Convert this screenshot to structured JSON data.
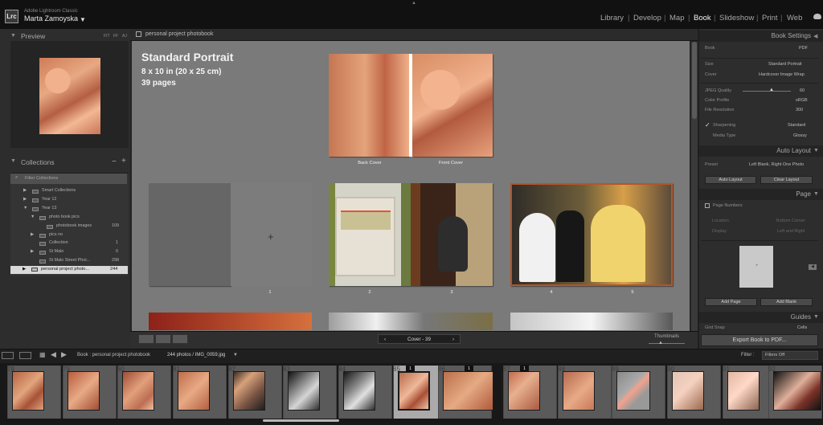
{
  "app": {
    "name": "Adobe Lightroom Classic",
    "logo": "Lrc",
    "user": "Marta Zamoyska"
  },
  "modules": [
    "Library",
    "Develop",
    "Map",
    "Book",
    "Slideshow",
    "Print",
    "Web"
  ],
  "left": {
    "preview_label": "Preview",
    "preview_buttons": [
      "FIT",
      "FF",
      "AJ"
    ],
    "collections_label": "Collections",
    "filter_label": "Filter Collections",
    "items": [
      {
        "label": "Smart Collections",
        "count": ""
      },
      {
        "label": "Year 12",
        "count": ""
      },
      {
        "label": "Year 13",
        "count": ""
      },
      {
        "label": "photo book pics",
        "count": ""
      },
      {
        "label": "photobook images",
        "count": "109"
      },
      {
        "label": "pics no",
        "count": ""
      },
      {
        "label": "Collection",
        "count": "1"
      },
      {
        "label": "St Malo",
        "count": "0"
      },
      {
        "label": "St Malo Street Phot...",
        "count": "298"
      },
      {
        "label": "personal project photo...",
        "count": "244"
      }
    ]
  },
  "center": {
    "title": "personal project photobook",
    "book_title": "Standard Portrait",
    "book_size": "8 x 10 in (20 x 25 cm)",
    "book_pages": "39 pages",
    "captions": {
      "back": "Back Cover",
      "front": "Front Cover",
      "p1": "1",
      "p2": "2",
      "p3": "3",
      "p4": "4",
      "p5": "5"
    },
    "nav": "Cover - 39",
    "thumbnails_label": "Thumbnails"
  },
  "right": {
    "book_settings": "Book Settings",
    "book": {
      "label": "Book",
      "value": "PDF"
    },
    "size": {
      "label": "Size",
      "value": "Standard Portrait"
    },
    "cover": {
      "label": "Cover",
      "value": "Hardcover Image Wrap"
    },
    "jpeg": {
      "label": "JPEG Quality",
      "value": "60"
    },
    "profile": {
      "label": "Color Profile",
      "value": "sRGB"
    },
    "resolution": {
      "label": "File Resolution",
      "value": "300"
    },
    "sharpening": {
      "label": "Sharpening",
      "value": "Standard"
    },
    "media": {
      "label": "Media Type",
      "value": "Glossy"
    },
    "auto_layout": "Auto Layout",
    "preset": {
      "label": "Preset",
      "value": "Left Blank, Right One Photo"
    },
    "auto_button": "Auto Layout",
    "clear_button": "Clear Layout",
    "page_header": "Page",
    "page_numbers": "Page Numbers",
    "location": {
      "label": "Location",
      "value": "Bottom Corner"
    },
    "display": {
      "label": "Display",
      "value": "Left and Right"
    },
    "add_page": "Add Page",
    "add_blank": "Add Blank",
    "guides": "Guides",
    "grid_snap": {
      "label": "Grid Snap",
      "value": "Cells"
    },
    "export": "Export Book to PDF..."
  },
  "filmstrip": {
    "path": "Book : personal project photobook",
    "count": "244 photos / IMG_0059.jpg",
    "filter_label": "Filter :",
    "filter_value": "Filters Off",
    "numbers": [
      "78",
      "79",
      "80",
      "81",
      "82",
      "83",
      "84",
      "85",
      "86",
      "87",
      "88",
      "89",
      "90",
      "91",
      "92"
    ],
    "badges": [
      "1",
      "1",
      "1"
    ]
  },
  "colors": {
    "accent": "#ffffff",
    "selected": "#d8d8d8",
    "canvas": "#7a7a7a",
    "dark": "#1f1f1f"
  }
}
